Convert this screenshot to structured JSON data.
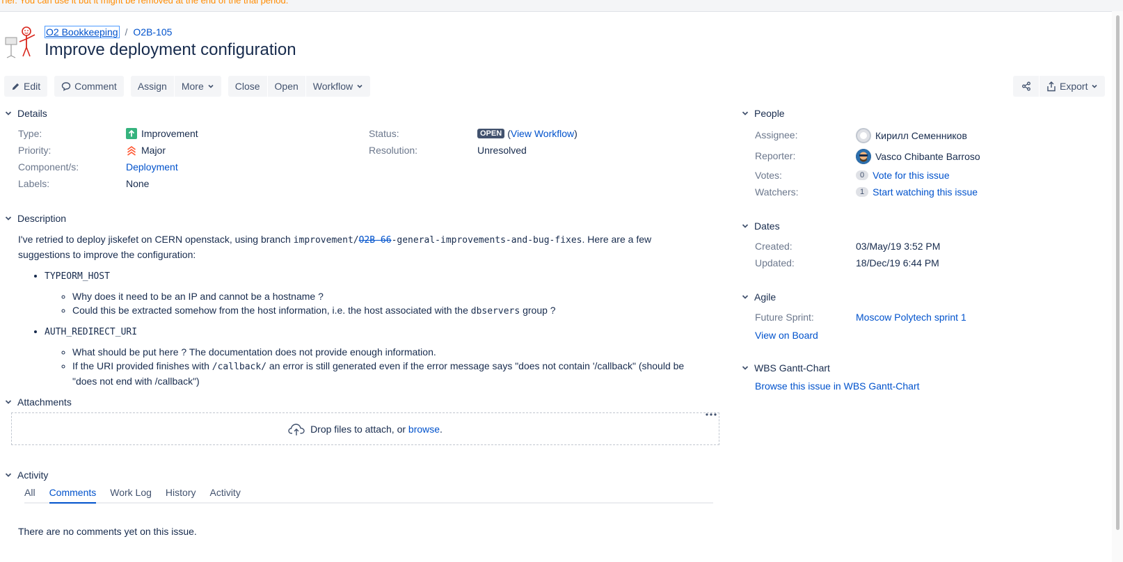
{
  "banner": {
    "text": "Tier. You can use it but it might be removed at the end of the trial period."
  },
  "breadcrumbs": {
    "project": "O2 Bookkeeping",
    "separator": "/",
    "issue_key": "O2B-105"
  },
  "issue": {
    "title": "Improve deployment configuration"
  },
  "toolbar": {
    "edit": "Edit",
    "comment": "Comment",
    "assign": "Assign",
    "more": "More",
    "close": "Close",
    "open": "Open",
    "workflow": "Workflow",
    "export": "Export"
  },
  "details": {
    "heading": "Details",
    "type_label": "Type:",
    "type_value": "Improvement",
    "priority_label": "Priority:",
    "priority_value": "Major",
    "components_label": "Component/s:",
    "components_value": "Deployment",
    "labels_label": "Labels:",
    "labels_value": "None",
    "status_label": "Status:",
    "status_value": "OPEN",
    "view_workflow": "View Workflow",
    "resolution_label": "Resolution:",
    "resolution_value": "Unresolved"
  },
  "description": {
    "heading": "Description",
    "intro_1": "I've retried to deploy jiskefet on CERN openstack, using branch ",
    "branch_prefix": "improvement/",
    "branch_struck": "O2B-66",
    "branch_suffix": "-general-improvements-and-bug-fixes",
    "intro_2": ". Here are a few suggestions to improve the configuration:",
    "item1_code": "TYPEORM_HOST",
    "item1_sub1": "Why does it need to be an IP and cannot be a hostname ?",
    "item1_sub2_a": "Could this be extracted somehow from the host information, i.e. the host associated with the ",
    "item1_sub2_code": "dbservers",
    "item1_sub2_b": " group ?",
    "item2_code": "AUTH_REDIRECT_URI",
    "item2_sub1": "What should be put here ? The documentation does not provide enough information.",
    "item2_sub2_a": "If the URI provided finishes with ",
    "item2_sub2_code": "/callback/",
    "item2_sub2_b": " an error is still generated even if the error message says \"does not contain '/callback\" (should be \"does not end with /callback\")"
  },
  "attachments": {
    "heading": "Attachments",
    "drop_text": "Drop files to attach, or ",
    "browse": "browse",
    "period": "."
  },
  "activity": {
    "heading": "Activity",
    "tabs": [
      "All",
      "Comments",
      "Work Log",
      "History",
      "Activity"
    ],
    "active_tab": "Comments",
    "empty": "There are no comments yet on this issue."
  },
  "people": {
    "heading": "People",
    "assignee_label": "Assignee:",
    "assignee_value": "Кирилл Семенников",
    "reporter_label": "Reporter:",
    "reporter_value": "Vasco Chibante Barroso",
    "votes_label": "Votes:",
    "votes_count": "0",
    "votes_link": "Vote for this issue",
    "watchers_label": "Watchers:",
    "watchers_count": "1",
    "watchers_link": "Start watching this issue"
  },
  "dates": {
    "heading": "Dates",
    "created_label": "Created:",
    "created_value": "03/May/19 3:52 PM",
    "updated_label": "Updated:",
    "updated_value": "18/Dec/19 6:44 PM"
  },
  "agile": {
    "heading": "Agile",
    "sprint_label": "Future Sprint:",
    "sprint_value": "Moscow Polytech sprint 1",
    "view_board": "View on Board"
  },
  "gantt": {
    "heading": "WBS Gantt-Chart",
    "link": "Browse this issue in WBS Gantt-Chart"
  },
  "colors": {
    "accent": "#0052cc",
    "improvement": "#36b37e",
    "major": "#ff5630",
    "status": "#42526e",
    "banner": "#ff8b00"
  }
}
